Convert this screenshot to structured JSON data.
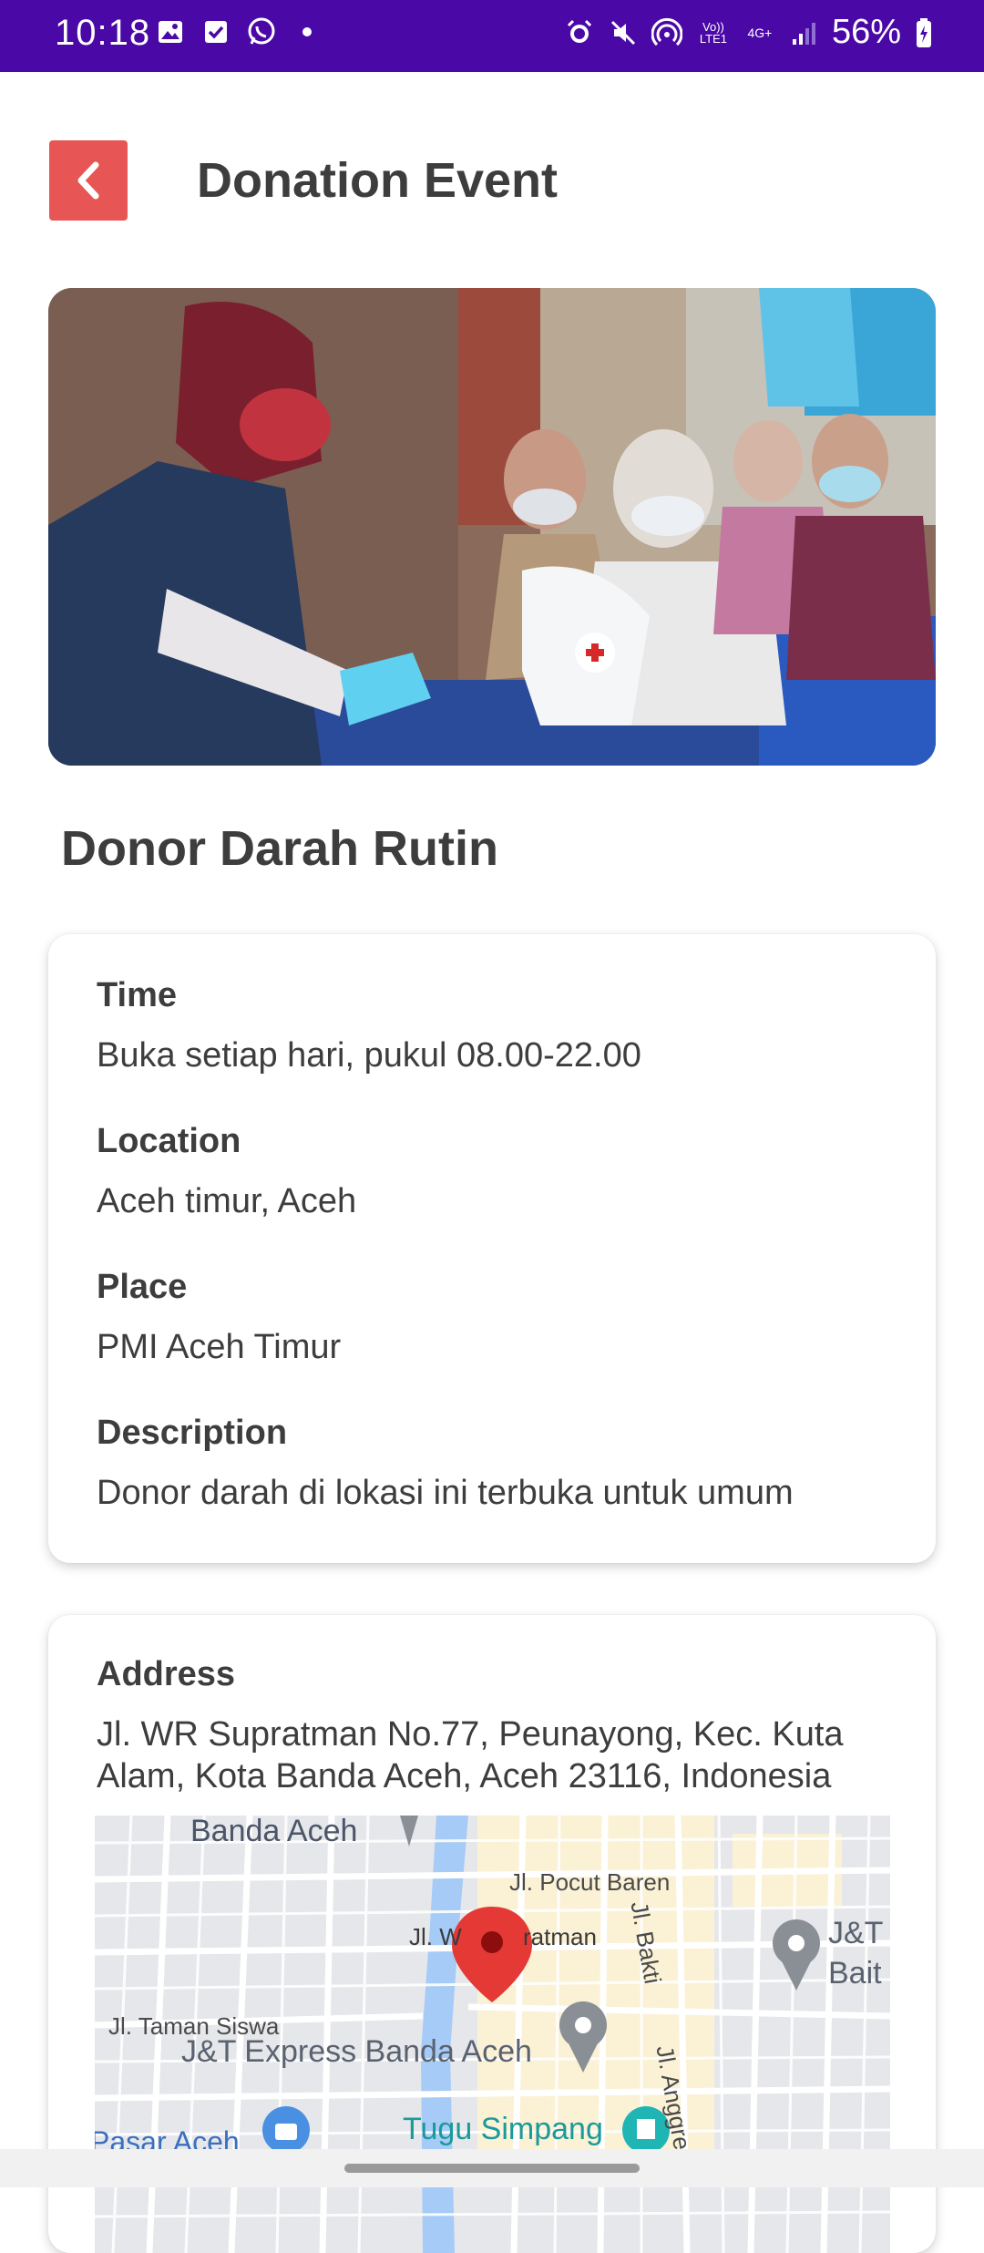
{
  "status_bar": {
    "time": "10:18",
    "battery": "56%",
    "network_label_1": "Vo)) LTE1",
    "network_label_2": "4G+",
    "left_icons": [
      "gallery-icon",
      "checkbox-icon",
      "whatsapp-icon",
      "dot-icon"
    ],
    "right_icons": [
      "alarm-icon",
      "mute-icon",
      "hotspot-icon",
      "volte-icon",
      "4g-icon",
      "signal-icon",
      "battery-icon"
    ]
  },
  "app_bar": {
    "title": "Donation Event",
    "back_icon": "chevron-left-icon",
    "back_color": "#e85555"
  },
  "event": {
    "name": "Donor Darah Rutin"
  },
  "details": {
    "time_label": "Time",
    "time_value": "Buka setiap hari, pukul 08.00-22.00",
    "location_label": "Location",
    "location_value": "Aceh timur, Aceh",
    "place_label": "Place",
    "place_value": "PMI Aceh Timur",
    "description_label": "Description",
    "description_value": "Donor darah di lokasi ini terbuka untuk umum"
  },
  "address": {
    "label": "Address",
    "value": "Jl. WR Supratman No.77, Peunayong, Kec. Kuta Alam, Kota Banda Aceh, Aceh 23116, Indonesia"
  },
  "map": {
    "labels": {
      "city": "Banda Aceh",
      "pocut": "Jl. Pocut Baren",
      "supratman_a": "Jl. W",
      "supratman_b": "ratman",
      "bakti": "Jl. Bakti",
      "jt_right_1": "J&T",
      "jt_right_2": "Bait",
      "taman": "Jl. Taman Siswa",
      "jt_main": "J&T Express Banda Aceh",
      "anggrek": "Jl. Anggrek",
      "pasar": "Pasar Aceh",
      "tugu": "Tugu Simpang"
    },
    "marker_color": "#e53935",
    "river_color": "#a6cbf7"
  },
  "colors": {
    "status_bar": "#4a08a6",
    "accent": "#e85555",
    "text": "#3d3d3d"
  }
}
